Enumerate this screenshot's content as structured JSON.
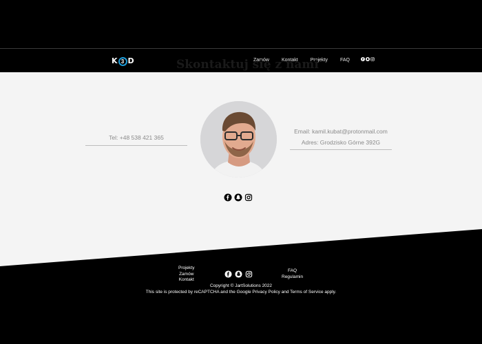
{
  "header": {
    "logo_left": "K",
    "logo_badge": "3",
    "logo_right": "D",
    "nav": [
      {
        "label": "Zamów"
      },
      {
        "label": "Kontakt"
      },
      {
        "label": "Projekty"
      },
      {
        "label": "FAQ"
      }
    ],
    "icons": [
      "facebook-icon",
      "snapchat-icon",
      "instagram-icon"
    ]
  },
  "page_title": "Skontaktuj się z nami",
  "contact": {
    "phone": "Tel: +48 538 421 365",
    "email": "Email: kamil.kubat@protonmail.com",
    "address": "Adres: Grodzisko Górne 392G"
  },
  "social": [
    "facebook-icon",
    "snapchat-icon",
    "instagram-icon"
  ],
  "footer": {
    "left_links": [
      "Projekty",
      "Zamów",
      "Kontakt"
    ],
    "right_links": [
      "FAQ",
      "Regulamin"
    ],
    "copyright": "Copyright © JartSolutions 2022",
    "recaptcha": "This site is protected by reCAPTCHA and the Google Privacy Policy and Terms of Service apply."
  },
  "colors": {
    "background": "#000000",
    "content_bg": "#f4f4f4",
    "logo_accent": "#1e9bd7",
    "muted_text": "#8a8a8a"
  }
}
